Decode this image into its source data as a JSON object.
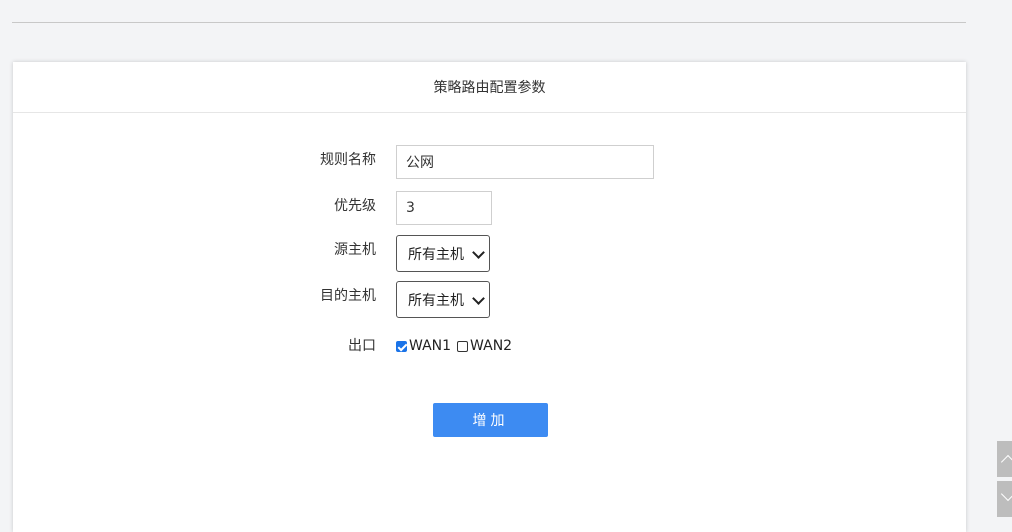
{
  "panel": {
    "title": "策略路由配置参数"
  },
  "form": {
    "rule_name": {
      "label": "规则名称",
      "value": "公网"
    },
    "priority": {
      "label": "优先级",
      "value": "3"
    },
    "source_host": {
      "label": "源主机",
      "selected": "所有主机"
    },
    "dest_host": {
      "label": "目的主机",
      "selected": "所有主机"
    },
    "exit": {
      "label": "出口",
      "options": [
        {
          "label": "WAN1",
          "checked": true
        },
        {
          "label": "WAN2",
          "checked": false
        }
      ]
    },
    "submit_label": "增加"
  },
  "icons": {
    "scroll_up": "chevron-up-icon",
    "scroll_down": "chevron-down-icon"
  },
  "colors": {
    "primary": "#3d8bf2",
    "background": "#f3f4f6"
  }
}
